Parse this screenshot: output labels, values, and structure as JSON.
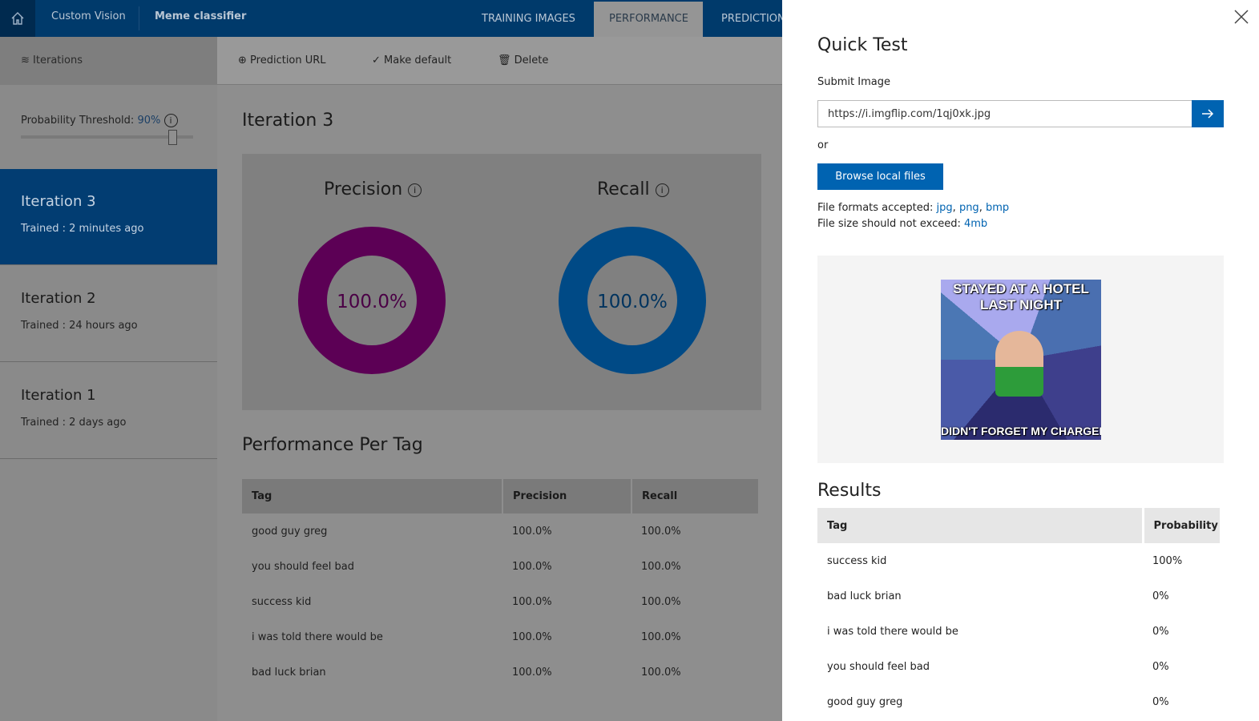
{
  "header": {
    "brand": "Custom Vision",
    "project": "Meme classifier",
    "tabs": [
      {
        "label": "TRAINING IMAGES"
      },
      {
        "label": "PERFORMANCE",
        "active": true
      },
      {
        "label": "PREDICTIONS"
      }
    ]
  },
  "sidebar": {
    "title": "Iterations",
    "threshold_label": "Probability Threshold:",
    "threshold_value": "90%",
    "threshold_fraction": 0.9,
    "iterations": [
      {
        "name": "Iteration 3",
        "trained": "Trained : 2 minutes ago",
        "selected": true
      },
      {
        "name": "Iteration 2",
        "trained": "Trained : 24 hours ago"
      },
      {
        "name": "Iteration 1",
        "trained": "Trained : 2 days ago"
      }
    ]
  },
  "toolbar": {
    "prediction_url": "Prediction URL",
    "make_default": "Make default",
    "delete": "Delete"
  },
  "main": {
    "title": "Iteration 3",
    "precision_label": "Precision",
    "recall_label": "Recall",
    "precision_value": "100.0%",
    "recall_value": "100.0%",
    "colors": {
      "precision": "#5c0055",
      "recall": "#004a86"
    },
    "per_tag_title": "Performance Per Tag",
    "columns": [
      "Tag",
      "Precision",
      "Recall"
    ],
    "rows": [
      [
        "good guy greg",
        "100.0%",
        "100.0%"
      ],
      [
        "you should feel bad",
        "100.0%",
        "100.0%"
      ],
      [
        "success kid",
        "100.0%",
        "100.0%"
      ],
      [
        "i was told there would be",
        "100.0%",
        "100.0%"
      ],
      [
        "bad luck brian",
        "100.0%",
        "100.0%"
      ]
    ]
  },
  "panel": {
    "title": "Quick Test",
    "submit_label": "Submit Image",
    "url_value": "https://i.imgflip.com/1qj0xk.jpg",
    "or": "or",
    "browse": "Browse local files",
    "formats_label": "File formats accepted:",
    "formats": [
      "jpg",
      "png",
      "bmp"
    ],
    "size_label": "File size should not exceed:",
    "size": "4mb",
    "meme_top": "STAYED AT A HOTEL LAST NIGHT",
    "meme_bottom": "DIDN'T FORGET MY CHARGER",
    "results_title": "Results",
    "columns": [
      "Tag",
      "Probability"
    ],
    "rows": [
      [
        "success kid",
        "100%"
      ],
      [
        "bad luck brian",
        "0%"
      ],
      [
        "i was told there would be",
        "0%"
      ],
      [
        "you should feel bad",
        "0%"
      ],
      [
        "good guy greg",
        "0%"
      ]
    ]
  }
}
